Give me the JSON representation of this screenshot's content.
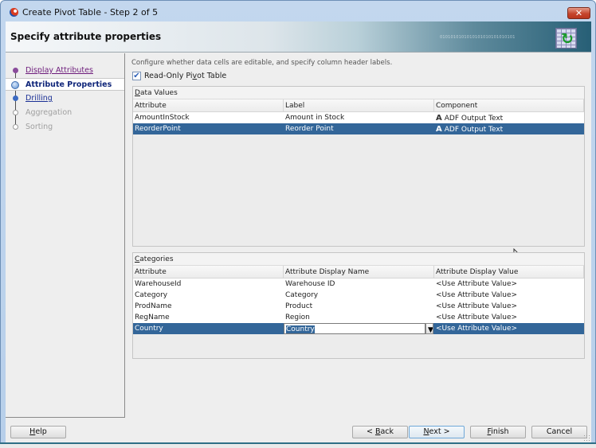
{
  "window": {
    "title": "Create Pivot Table - Step 2 of 5",
    "close_label": "✕"
  },
  "header": {
    "title": "Specify attribute properties",
    "binary_decoration": "0101010101010101010101010101"
  },
  "sidebar": {
    "steps": [
      {
        "label": "Display Attributes",
        "state": "visited"
      },
      {
        "label": "Attribute Properties",
        "state": "current"
      },
      {
        "label": "Drilling",
        "state": "link"
      },
      {
        "label": "Aggregation",
        "state": "disabled"
      },
      {
        "label": "Sorting",
        "state": "disabled"
      }
    ]
  },
  "main": {
    "intro": "Configure whether data cells are editable, and specify column header labels.",
    "read_only": {
      "label_pre": "Read-Only Pi",
      "label_mnemonic": "v",
      "label_post": "ot Table",
      "checked": true,
      "check_glyph": "✔"
    },
    "data_values": {
      "title_mnemonic": "D",
      "title_rest": "ata Values",
      "columns": [
        "Attribute",
        "Label",
        "Component"
      ],
      "rows": [
        {
          "attribute": "AmountInStock",
          "label": "Amount in Stock",
          "component": "ADF Output Text",
          "selected": false
        },
        {
          "attribute": "ReorderPoint",
          "label": "Reorder Point",
          "component": "ADF Output Text",
          "selected": true
        }
      ],
      "component_icon_glyph": "A"
    },
    "categories": {
      "title_mnemonic": "C",
      "title_rest": "ategories",
      "columns": [
        "Attribute",
        "Attribute Display Name",
        "Attribute Display Value"
      ],
      "rows": [
        {
          "attribute": "WarehouseId",
          "display_name": "Warehouse ID",
          "display_value": "<Use Attribute Value>"
        },
        {
          "attribute": "Category",
          "display_name": "Category",
          "display_value": "<Use Attribute Value>"
        },
        {
          "attribute": "ProdName",
          "display_name": "Product",
          "display_value": "<Use Attribute Value>"
        },
        {
          "attribute": "RegName",
          "display_name": "Region",
          "display_value": "<Use Attribute Value>"
        },
        {
          "attribute": "Country",
          "display_name": "Country",
          "display_value": "<Use Attribute Value>",
          "selected": true,
          "editing": true
        }
      ],
      "dropdown_glyph": "▼"
    }
  },
  "footer": {
    "help": {
      "mnemonic": "H",
      "rest": "elp"
    },
    "back": {
      "pre": "< ",
      "mnemonic": "B",
      "rest": "ack"
    },
    "next": {
      "mnemonic": "N",
      "rest": "ext >"
    },
    "finish": {
      "mnemonic": "F",
      "rest": "inish"
    },
    "cancel": {
      "label": "Cancel"
    }
  }
}
